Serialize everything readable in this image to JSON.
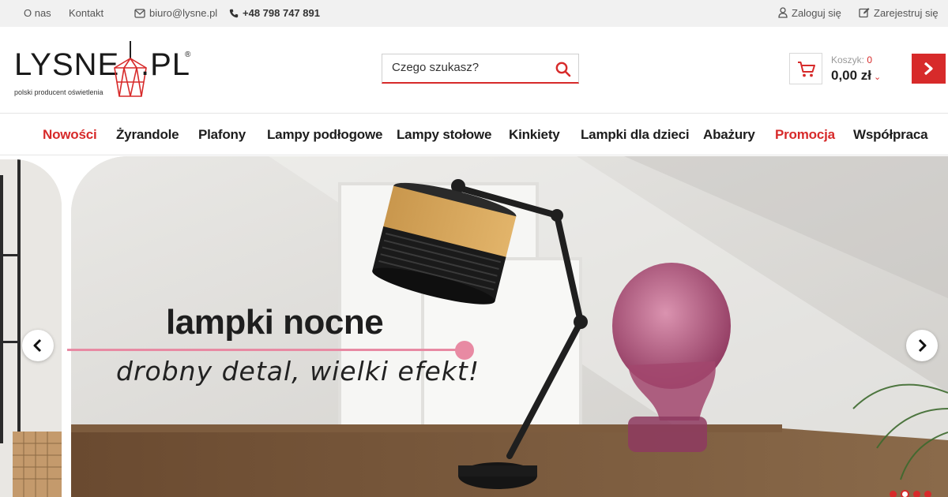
{
  "topbar": {
    "about": "O nas",
    "contact": "Kontakt",
    "email": "biuro@lysne.pl",
    "phone": "+48 798 747 891",
    "login": "Zaloguj się",
    "register": "Zarejestruj się"
  },
  "logo": {
    "brand": "LYSNE",
    "tld": ".PL",
    "reg": "®",
    "tagline": "polski producent oświetlenia"
  },
  "search": {
    "placeholder": "Czego szukasz?"
  },
  "cart": {
    "label": "Koszyk:",
    "count": "0",
    "total": "0,00 zł"
  },
  "nav": {
    "items": [
      {
        "label": "Nowości",
        "highlight": true
      },
      {
        "label": "Żyrandole",
        "highlight": false
      },
      {
        "label": "Plafony",
        "highlight": false
      },
      {
        "label": "Lampy podłogowe",
        "highlight": false
      },
      {
        "label": "Lampy stołowe",
        "highlight": false
      },
      {
        "label": "Kinkiety",
        "highlight": false
      },
      {
        "label": "Lampki dla dzieci",
        "highlight": false
      },
      {
        "label": "Abażury",
        "highlight": false
      },
      {
        "label": "Promocja",
        "highlight": true
      },
      {
        "label": "Współpraca",
        "highlight": false
      }
    ]
  },
  "hero": {
    "title": "lampki nocne",
    "subtitle": "drobny detal, wielki efekt!",
    "slide_count": 4,
    "active_slide": 2
  },
  "colors": {
    "accent": "#d72a2a",
    "pink": "#e88aa3",
    "topbar_bg": "#f1f1f1"
  },
  "icons": {
    "email": "envelope-icon",
    "phone": "phone-icon",
    "login": "user-icon",
    "register": "edit-icon",
    "search": "search-icon",
    "cart": "cart-icon"
  }
}
